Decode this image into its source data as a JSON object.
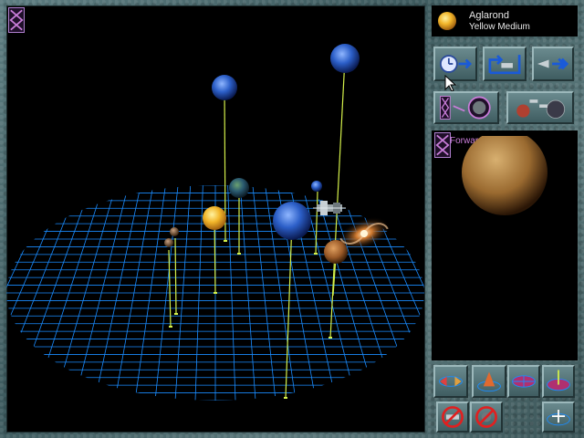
{
  "star": {
    "name": "Aglarond",
    "type": "Yellow Medium",
    "color": "#f2b62a"
  },
  "planet_panel": {
    "name": "Forward Station",
    "color": "#b8884a"
  },
  "colors": {
    "grid": "#1a8cff",
    "stalk": "#d4f04a",
    "selection": "#c87cd8"
  },
  "buttons": {
    "top_row": [
      "time-advance-icon",
      "return-to-system-icon",
      "fleet-move-icon"
    ],
    "second_row": [
      "planet-view-icon",
      "fleet-list-icon"
    ],
    "bottom_row1": [
      "rotate-left-right-icon",
      "tilt-view-icon",
      "grid-flat-icon",
      "grid-axis-icon"
    ],
    "bottom_row2": [
      "no-ships-filter-icon",
      "no-planets-filter-icon",
      "grid-add-icon"
    ]
  }
}
